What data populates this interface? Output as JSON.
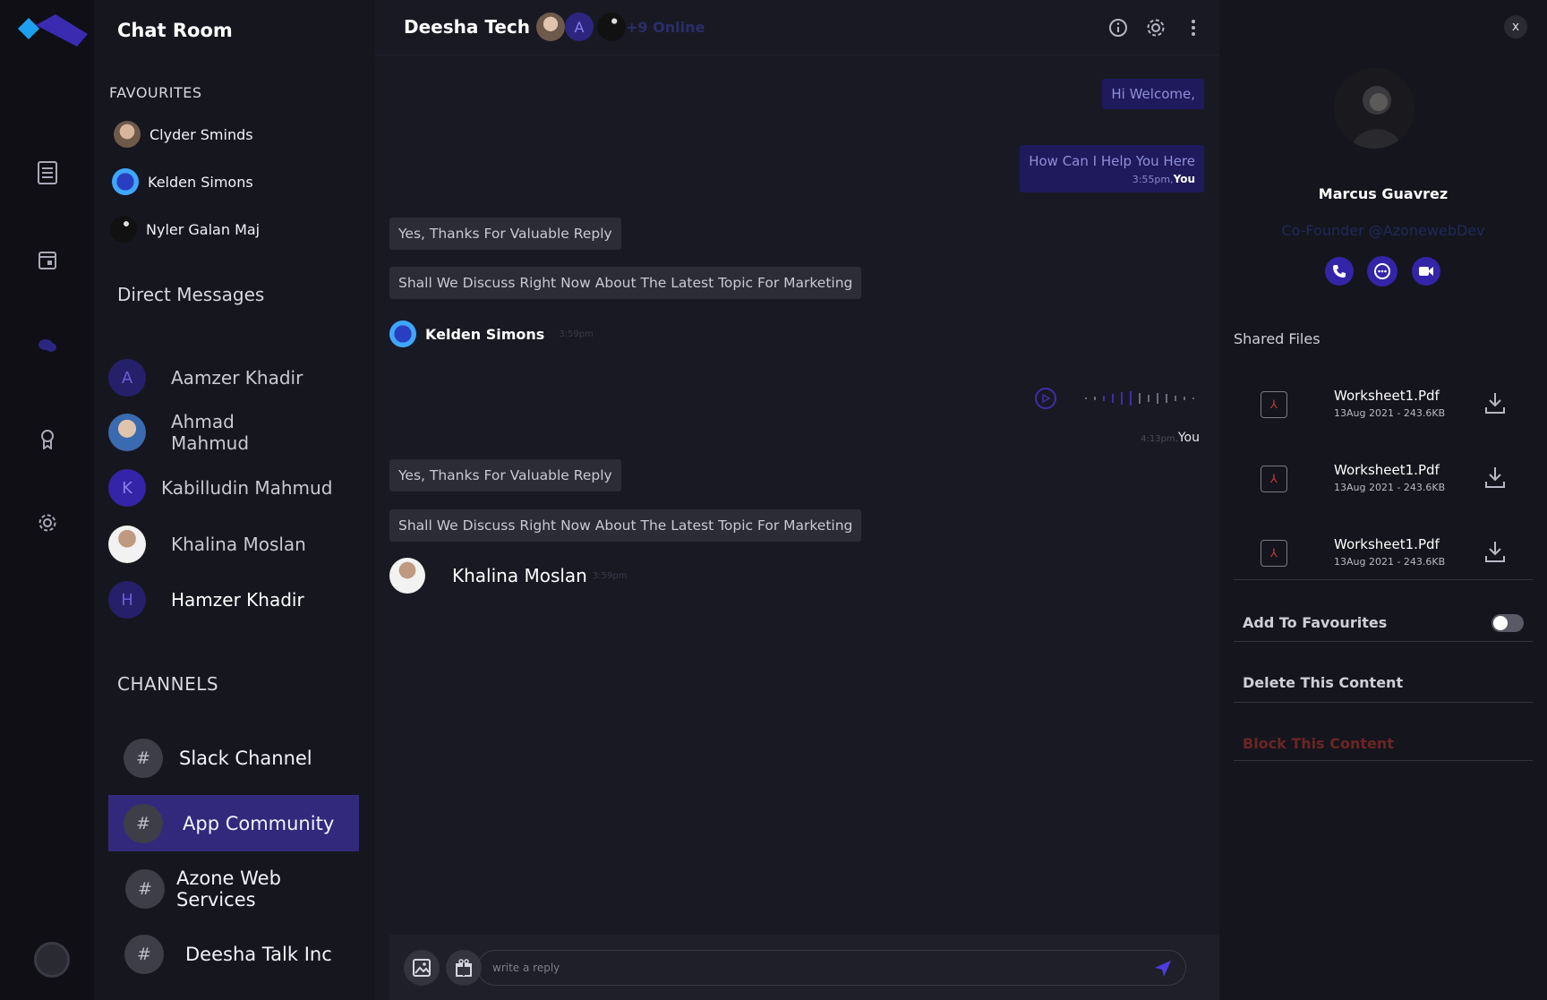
{
  "sidebar": {
    "title": "Chat Room",
    "favourites_header": "FAVOURITES",
    "favourites": [
      {
        "name": "Clyder Sminds"
      },
      {
        "name": "Kelden Simons"
      },
      {
        "name": "Nyler Galan Maj"
      }
    ],
    "dm_header": "Direct Messages",
    "direct_messages": [
      {
        "name": "Aamzer Khadir",
        "initial": "A"
      },
      {
        "name": "Ahmad Mahmud",
        "initial": ""
      },
      {
        "name": "Kabilludin Mahmud",
        "initial": "K"
      },
      {
        "name": "Khalina Moslan",
        "initial": ""
      },
      {
        "name": "Hamzer Khadir",
        "initial": "H"
      }
    ],
    "channels_header": "CHANNELS",
    "channels": [
      {
        "name": "Slack Channel",
        "icon": "#"
      },
      {
        "name": "App Community",
        "icon": "#",
        "active": true
      },
      {
        "name": "Azone Web Services",
        "icon": "#"
      },
      {
        "name": "Deesha Talk Inc",
        "icon": "#"
      }
    ]
  },
  "chat": {
    "title": "Deesha Tech",
    "header_avatar_initial": "A",
    "online_text": "+9 Online",
    "messages": {
      "m1": "Hi Welcome,",
      "m2": "How Can I Help You Here",
      "m2_time": "3:55pm,",
      "m2_sender": "You",
      "m3": "Yes, Thanks For Valuable Reply",
      "m4": "Shall We Discuss Right Now About The Latest Topic For Marketing",
      "s1_name": "Kelden Simons",
      "s1_time": "3:59pm",
      "audio_time": "4:13pm,",
      "audio_sender": "You",
      "m5": "Yes, Thanks For Valuable Reply",
      "m6": "Shall We Discuss Right Now About The Latest Topic For Marketing",
      "s2_name": "Khalina Moslan",
      "s2_time": "3:59pm"
    },
    "composer": {
      "placeholder": "write a reply"
    }
  },
  "profile": {
    "close": "x",
    "name": "Marcus Guavrez",
    "role": "Co-Founder @AzonewebDev",
    "shared_files_header": "Shared Files",
    "files": [
      {
        "name": "Worksheet1.Pdf",
        "meta": "13Aug 2021 - 243.6KB"
      },
      {
        "name": "Worksheet1.Pdf",
        "meta": "13Aug 2021 - 243.6KB"
      },
      {
        "name": "Worksheet1.Pdf",
        "meta": "13Aug 2021 - 243.6KB"
      }
    ],
    "add_favourites": "Add To Favourites",
    "add_favourites_on": false,
    "delete": "Delete This Content",
    "block": "Block This Content"
  },
  "colors": {
    "accent": "#3424a8",
    "active_channel": "#32297d",
    "danger": "#6b2525"
  }
}
